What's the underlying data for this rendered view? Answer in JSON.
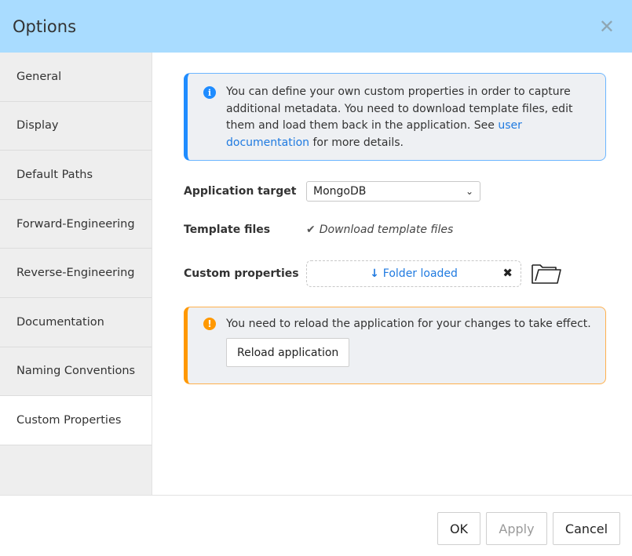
{
  "dialog": {
    "title": "Options",
    "close_icon": "close-icon"
  },
  "sidebar": {
    "items": [
      {
        "label": "General"
      },
      {
        "label": "Display"
      },
      {
        "label": "Default Paths"
      },
      {
        "label": "Forward-Engineering"
      },
      {
        "label": "Reverse-Engineering"
      },
      {
        "label": "Documentation"
      },
      {
        "label": "Naming Conventions"
      },
      {
        "label": "Custom Properties",
        "active": true
      }
    ]
  },
  "info": {
    "icon": "info-icon",
    "text_before_link": "You can define your own custom properties in order to capture additional metadata. You need to download template files, edit them and load them back in the application. See ",
    "link_text": "user documentation",
    "text_after_link": " for more details."
  },
  "form": {
    "app_target": {
      "label": "Application target",
      "value": "MongoDB"
    },
    "template_files": {
      "label": "Template files",
      "link": "Download template files",
      "icon": "checkmark-icon"
    },
    "custom_properties": {
      "label": "Custom properties",
      "status": "Folder loaded",
      "remove_glyph": "✖",
      "icon": "folder-icon"
    }
  },
  "warning": {
    "icon": "warning-icon",
    "text": "You need to reload the application for your changes to take effect.",
    "button": "Reload application"
  },
  "footer": {
    "ok": "OK",
    "apply": "Apply",
    "cancel": "Cancel"
  },
  "colors": {
    "header_bg": "#a9dcff",
    "accent_blue": "#1f8cff",
    "accent_orange": "#ff9800",
    "link": "#1f7ae0"
  }
}
